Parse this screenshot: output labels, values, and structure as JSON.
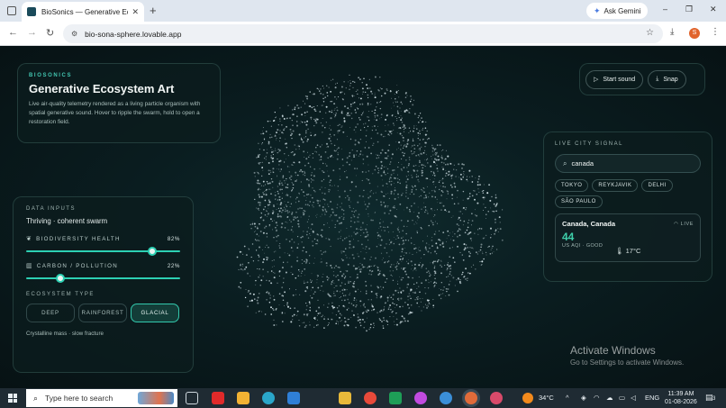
{
  "browser": {
    "tab_title": "BioSonics — Generative Ecosystem",
    "new_tab": "+",
    "ask_gemini": "Ask Gemini",
    "url": "bio-sona-sphere.lovable.app",
    "avatar_initial": "S",
    "window_controls": [
      "–",
      "❐",
      "✕"
    ]
  },
  "hero": {
    "kicker": "BIOSONICS",
    "title": "Generative Ecosystem Art",
    "description": "Live air-quality telemetry rendered as a living particle organism with spatial generative sound. Hover to ripple the swarm, hold to open a restoration field."
  },
  "controls": {
    "start_sound": "Start sound",
    "snap": "Snap"
  },
  "city_signal": {
    "label": "LIVE CITY SIGNAL",
    "search_value": "canada",
    "chips": [
      "TOKYO",
      "REYKJAVIK",
      "DELHI",
      "SÃO PAULO"
    ],
    "card": {
      "city": "Canada, Canada",
      "live": "LIVE",
      "aqi": "44",
      "aqi_label": "US AQI · GOOD",
      "temp": "17°C"
    }
  },
  "data_inputs": {
    "label": "DATA INPUTS",
    "status": "Thriving · coherent swarm",
    "biodiversity": {
      "label": "BIODIVERSITY HEALTH",
      "value": "82%",
      "fraction": 0.82
    },
    "carbon": {
      "label": "CARBON / POLLUTION",
      "value": "22%",
      "fraction": 0.22
    },
    "ecosystem_label": "ECOSYSTEM TYPE",
    "types": [
      "DEEP",
      "RAINFOREST",
      "GLACIAL"
    ],
    "active_type": "GLACIAL",
    "type_note": "Crystalline mass · slow fracture"
  },
  "watermark": {
    "line1": "Activate Windows",
    "line2": "Go to Settings to activate Windows."
  },
  "taskbar": {
    "search_placeholder": "Type here to search",
    "weather": "34°C",
    "language": "ENG",
    "time": "11:39 AM",
    "date": "01-08-2026",
    "notifications": "3"
  },
  "colors": {
    "accent": "#2dd0b3",
    "aqi_good": "#3ecfaa",
    "background": "#0a1518"
  }
}
